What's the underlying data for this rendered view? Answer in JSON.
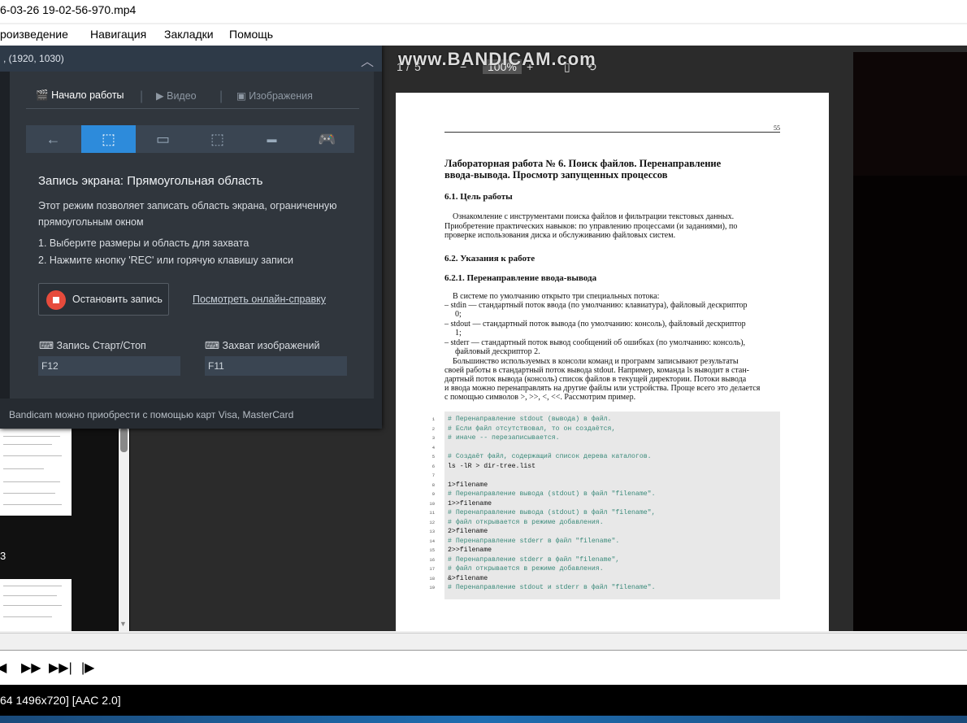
{
  "window": {
    "title": "6-03-26 19-02-56-970.mp4"
  },
  "menu": [
    "роизведение",
    "Навигация",
    "Закладки",
    "Помощь"
  ],
  "bandicam": {
    "header": ", (1920, 1030)",
    "tabs": [
      "Начало работы",
      "Видео",
      "Изображения"
    ],
    "mode_title": "Запись экрана: Прямоугольная область",
    "desc_line1": "Этот режим позволяет записать область экрана, ограниченную",
    "desc_line2": "прямоугольным окном",
    "step1": "1. Выберите размеры и область для захвата",
    "step2": "2. Нажмите кнопку 'REC' или горячую клавишу записи",
    "stop_label": "Остановить запись",
    "help_link": "Посмотреть онлайн-справку",
    "hotkey1_label": "Запись Старт/Стоп",
    "hotkey1_value": "F12",
    "hotkey2_label": "Захват изображений",
    "hotkey2_value": "F11",
    "footer": "Bandicam можно приобрести с помощью карт Visa, MasterCard"
  },
  "watermark": "www.BANDICAM.com",
  "pdf_toolbar": {
    "page": "1",
    "sep": "/",
    "total": "5",
    "minus": "−",
    "zoom": "100%",
    "plus": "+"
  },
  "thumb_page_number": "3",
  "page": {
    "number": "55",
    "title_line1": "Лабораторная работа № 6.   Поиск файлов. Перенаправление",
    "title_line2": "ввода-вывода. Просмотр запущенных процессов",
    "s61": "6.1.   Цель работы",
    "p61_1": "Ознакомление с инструментами поиска файлов и фильтрации текстовых данных.",
    "p61_2": "Приобретение практических навыков: по управлению процессами (и заданиями), по",
    "p61_3": "проверке использования диска и обслуживанию файловых систем.",
    "s62": "6.2.   Указания к работе",
    "s621": "6.2.1.   Перенаправление ввода-вывода",
    "b0": "В системе по умолчанию открыто три специальных потока:",
    "b1a": "– stdin — стандартный поток ввода (по умолчанию: клавиатура), файловый дескриптор",
    "b1b": "0;",
    "b2a": "– stdout — стандартный поток вывода (по умолчанию: консоль), файловый дескриптор",
    "b2b": "1;",
    "b3a": "– stderr — стандартный поток вывод сообщений об ошибках (по умолчанию: консоль),",
    "b3b": "файловый дескриптор 2.",
    "q1": "Большинство используемых в консоли команд и программ записывают результаты",
    "q2": "своей работы в стандартный поток вывода stdout. Например, команда ls выводит в стан-",
    "q3": "дартный поток вывода (консоль) список файлов в текущей директории. Потоки вывода",
    "q4": "и ввода можно перенаправлять на другие файлы или устройства. Проще всего это делается",
    "q5": "с помощью символов >, >>, <, <<. Рассмотрим пример.",
    "code": [
      "# Перенаправление stdout (вывода) в файл.",
      "# Если файл отсутствовал, то он создаётся,",
      "# иначе -- перезаписывается.",
      "",
      "# Создаёт файл, содержащий список дерева каталогов.",
      "ls -lR > dir-tree.list",
      "",
      "1>filename",
      "# Перенаправление вывода (stdout) в файл \"filename\".",
      "1>>filename",
      "# Перенаправление вывода (stdout) в файл \"filename\",",
      "# файл открывается в режиме добавления.",
      "2>filename",
      "# Перенаправление stderr в файл \"filename\".",
      "2>>filename",
      "# Перенаправление stderr в файл \"filename\",",
      "# файл открывается в режиме добавления.",
      "&>filename",
      "# Перенаправление stdout и stderr в файл \"filename\"."
    ],
    "line_numbers": [
      "1",
      "2",
      "3",
      "4",
      "5",
      "6",
      "7",
      "8",
      "9",
      "10",
      "11",
      "12",
      "13",
      "14",
      "15",
      "16",
      "17",
      "18",
      "19"
    ]
  },
  "controls": {
    "prev": "◀",
    "ff": "▶▶",
    "next": "▶▶|",
    "frame": "|▶"
  },
  "status": "64 1496x720]   [AAC 2.0]"
}
